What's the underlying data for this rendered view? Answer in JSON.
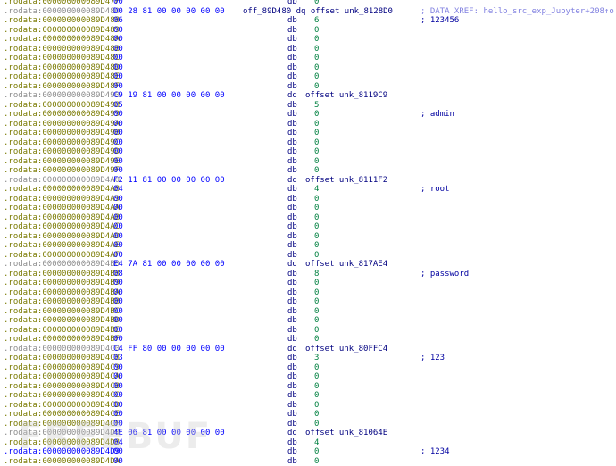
{
  "watermark": "FREEBUF",
  "rows": [
    {
      "seg": ".rodata:",
      "addr": "000000000089D47F",
      "bytes": "00",
      "mn": "db",
      "op": "0"
    },
    {
      "seg": ".rodata:",
      "addr": "000000000089D480",
      "bytes": "D0 28 81 00 00 00 00 00",
      "label": "off_89D480 dq offset unk_8128D0",
      "comment": "; DATA XREF: hello_src_exp_Jupyter+208↑o",
      "dq": true
    },
    {
      "seg": ".rodata:",
      "addr": "000000000089D488",
      "bytes": "06",
      "mn": "db",
      "op": "6",
      "comment": "; 123456"
    },
    {
      "seg": ".rodata:",
      "addr": "000000000089D489",
      "bytes": "00",
      "mn": "db",
      "op": "0"
    },
    {
      "seg": ".rodata:",
      "addr": "000000000089D48A",
      "bytes": "00",
      "mn": "db",
      "op": "0"
    },
    {
      "seg": ".rodata:",
      "addr": "000000000089D48B",
      "bytes": "00",
      "mn": "db",
      "op": "0"
    },
    {
      "seg": ".rodata:",
      "addr": "000000000089D48C",
      "bytes": "00",
      "mn": "db",
      "op": "0"
    },
    {
      "seg": ".rodata:",
      "addr": "000000000089D48D",
      "bytes": "00",
      "mn": "db",
      "op": "0"
    },
    {
      "seg": ".rodata:",
      "addr": "000000000089D48E",
      "bytes": "00",
      "mn": "db",
      "op": "0"
    },
    {
      "seg": ".rodata:",
      "addr": "000000000089D48F",
      "bytes": "00",
      "mn": "db",
      "op": "0"
    },
    {
      "seg": ".rodata:",
      "addr": "000000000089D490",
      "bytes": "C9 19 81 00 00 00 00 00",
      "mn": "dq",
      "dqop": "offset unk_8119C9",
      "dq": true
    },
    {
      "seg": ".rodata:",
      "addr": "000000000089D498",
      "bytes": "05",
      "mn": "db",
      "op": "5"
    },
    {
      "seg": ".rodata:",
      "addr": "000000000089D499",
      "bytes": "00",
      "mn": "db",
      "op": "0",
      "comment": "; admin"
    },
    {
      "seg": ".rodata:",
      "addr": "000000000089D49A",
      "bytes": "00",
      "mn": "db",
      "op": "0"
    },
    {
      "seg": ".rodata:",
      "addr": "000000000089D49B",
      "bytes": "00",
      "mn": "db",
      "op": "0"
    },
    {
      "seg": ".rodata:",
      "addr": "000000000089D49C",
      "bytes": "00",
      "mn": "db",
      "op": "0"
    },
    {
      "seg": ".rodata:",
      "addr": "000000000089D49D",
      "bytes": "00",
      "mn": "db",
      "op": "0"
    },
    {
      "seg": ".rodata:",
      "addr": "000000000089D49E",
      "bytes": "00",
      "mn": "db",
      "op": "0"
    },
    {
      "seg": ".rodata:",
      "addr": "000000000089D49F",
      "bytes": "00",
      "mn": "db",
      "op": "0"
    },
    {
      "seg": ".rodata:",
      "addr": "000000000089D4A0",
      "bytes": "F2 11 81 00 00 00 00 00",
      "mn": "dq",
      "dqop": "offset unk_8111F2",
      "dq": true
    },
    {
      "seg": ".rodata:",
      "addr": "000000000089D4A8",
      "bytes": "04",
      "mn": "db",
      "op": "4",
      "comment": "; root"
    },
    {
      "seg": ".rodata:",
      "addr": "000000000089D4A9",
      "bytes": "00",
      "mn": "db",
      "op": "0"
    },
    {
      "seg": ".rodata:",
      "addr": "000000000089D4AA",
      "bytes": "00",
      "mn": "db",
      "op": "0"
    },
    {
      "seg": ".rodata:",
      "addr": "000000000089D4AB",
      "bytes": "00",
      "mn": "db",
      "op": "0"
    },
    {
      "seg": ".rodata:",
      "addr": "000000000089D4AC",
      "bytes": "00",
      "mn": "db",
      "op": "0"
    },
    {
      "seg": ".rodata:",
      "addr": "000000000089D4AD",
      "bytes": "00",
      "mn": "db",
      "op": "0"
    },
    {
      "seg": ".rodata:",
      "addr": "000000000089D4AE",
      "bytes": "00",
      "mn": "db",
      "op": "0"
    },
    {
      "seg": ".rodata:",
      "addr": "000000000089D4AF",
      "bytes": "00",
      "mn": "db",
      "op": "0"
    },
    {
      "seg": ".rodata:",
      "addr": "000000000089D4B0",
      "bytes": "E4 7A 81 00 00 00 00 00",
      "mn": "dq",
      "dqop": "offset unk_817AE4",
      "dq": true
    },
    {
      "seg": ".rodata:",
      "addr": "000000000089D4B8",
      "bytes": "08",
      "mn": "db",
      "op": "8",
      "comment": "; password"
    },
    {
      "seg": ".rodata:",
      "addr": "000000000089D4B9",
      "bytes": "00",
      "mn": "db",
      "op": "0"
    },
    {
      "seg": ".rodata:",
      "addr": "000000000089D4BA",
      "bytes": "00",
      "mn": "db",
      "op": "0"
    },
    {
      "seg": ".rodata:",
      "addr": "000000000089D4BB",
      "bytes": "00",
      "mn": "db",
      "op": "0"
    },
    {
      "seg": ".rodata:",
      "addr": "000000000089D4BC",
      "bytes": "00",
      "mn": "db",
      "op": "0"
    },
    {
      "seg": ".rodata:",
      "addr": "000000000089D4BD",
      "bytes": "00",
      "mn": "db",
      "op": "0"
    },
    {
      "seg": ".rodata:",
      "addr": "000000000089D4BE",
      "bytes": "00",
      "mn": "db",
      "op": "0"
    },
    {
      "seg": ".rodata:",
      "addr": "000000000089D4BF",
      "bytes": "00",
      "mn": "db",
      "op": "0"
    },
    {
      "seg": ".rodata:",
      "addr": "000000000089D4C0",
      "bytes": "C4 FF 80 00 00 00 00 00",
      "mn": "dq",
      "dqop": "offset unk_80FFC4",
      "dq": true
    },
    {
      "seg": ".rodata:",
      "addr": "000000000089D4C8",
      "bytes": "03",
      "mn": "db",
      "op": "3",
      "comment": "; 123"
    },
    {
      "seg": ".rodata:",
      "addr": "000000000089D4C9",
      "bytes": "00",
      "mn": "db",
      "op": "0"
    },
    {
      "seg": ".rodata:",
      "addr": "000000000089D4CA",
      "bytes": "00",
      "mn": "db",
      "op": "0"
    },
    {
      "seg": ".rodata:",
      "addr": "000000000089D4CB",
      "bytes": "00",
      "mn": "db",
      "op": "0"
    },
    {
      "seg": ".rodata:",
      "addr": "000000000089D4CC",
      "bytes": "00",
      "mn": "db",
      "op": "0"
    },
    {
      "seg": ".rodata:",
      "addr": "000000000089D4CD",
      "bytes": "00",
      "mn": "db",
      "op": "0"
    },
    {
      "seg": ".rodata:",
      "addr": "000000000089D4CE",
      "bytes": "00",
      "mn": "db",
      "op": "0"
    },
    {
      "seg": ".rodata:",
      "addr": "000000000089D4CF",
      "bytes": "00",
      "mn": "db",
      "op": "0"
    },
    {
      "seg": ".rodata:",
      "addr": "000000000089D4D0",
      "bytes": "4E 06 81 00 00 00 00 00",
      "mn": "dq",
      "dqop": "offset unk_81064E",
      "dq": true
    },
    {
      "seg": ".rodata:",
      "addr": "000000000089D4D8",
      "bytes": "04",
      "mn": "db",
      "op": "4"
    },
    {
      "seg": ".rodata:",
      "addr": "000000000089D4D9",
      "bytes": "00",
      "mn": "db",
      "op": "0",
      "comment": "; 1234",
      "current": true
    },
    {
      "seg": ".rodata:",
      "addr": "000000000089D4DA",
      "bytes": "00",
      "mn": "db",
      "op": "0"
    }
  ]
}
